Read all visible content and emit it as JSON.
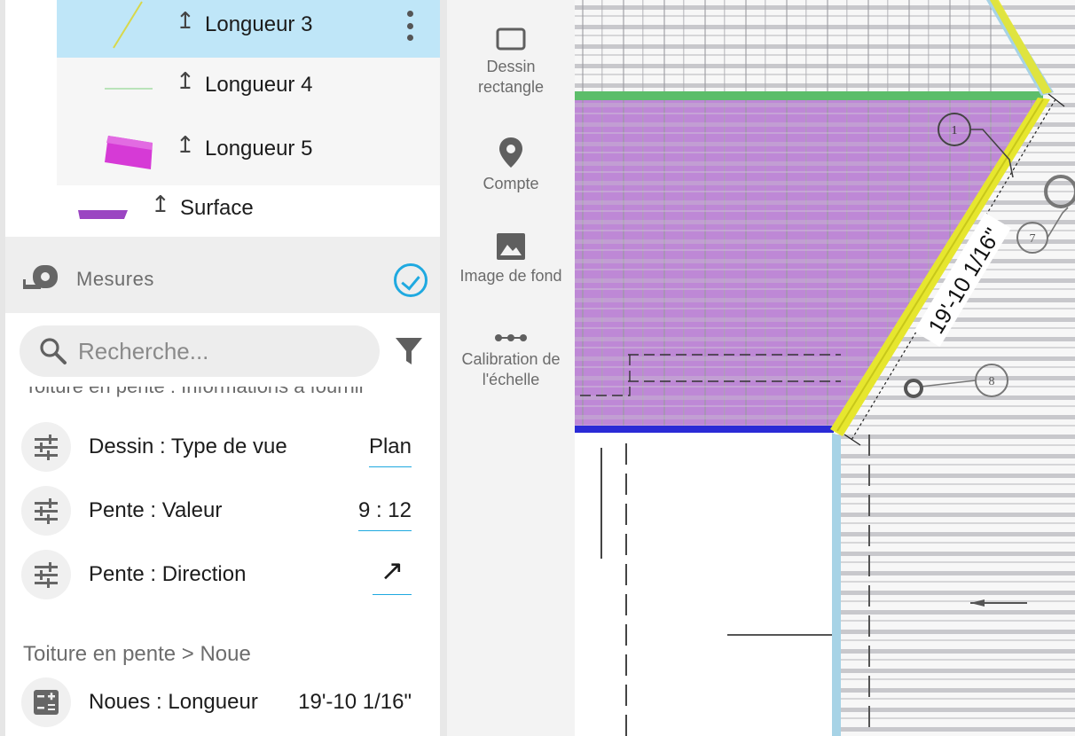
{
  "layers": [
    {
      "label": "Longueur 3",
      "pin": "↥",
      "selected": true,
      "thumb": "yellow-line"
    },
    {
      "label": "Longueur 4",
      "pin": "↥",
      "selected": false,
      "thumb": "green-line"
    },
    {
      "label": "Longueur 5",
      "pin": "↥",
      "selected": false,
      "thumb": "magenta-box"
    },
    {
      "label": "Surface",
      "pin": "↥",
      "selected": false,
      "thumb": "purple-bar"
    }
  ],
  "measures": {
    "label": "Mesures",
    "checked": true
  },
  "search": {
    "placeholder": "Recherche..."
  },
  "cut_header": "Toiture en pente : Informations à fournir",
  "properties": [
    {
      "name": "Dessin : Type de vue",
      "value": "Plan",
      "icon": "sliders-icon"
    },
    {
      "name": "Pente : Valeur",
      "value": "9 : 12",
      "icon": "sliders-icon"
    },
    {
      "name": "Pente : Direction",
      "value": "↗",
      "icon": "sliders-icon"
    }
  ],
  "section": {
    "title": "Toiture en pente > Noue"
  },
  "noue": {
    "name": "Noues : Longueur",
    "value": "19'-10 1/16\"",
    "icon": "calculator-icon"
  },
  "tools": [
    {
      "label_line1": "Dessin",
      "label_line2": "rectangle",
      "icon": "rectangle-icon"
    },
    {
      "label_line1": "Compte",
      "label_line2": "",
      "icon": "location-pin-icon"
    },
    {
      "label_line1": "Image de fond",
      "label_line2": "",
      "icon": "image-icon"
    },
    {
      "label_line1": "Calibration de",
      "label_line2": "l'échelle",
      "icon": "calibration-icon"
    }
  ],
  "canvas": {
    "dimension_label": "19'-10 1/16\"",
    "callouts": [
      "1",
      "7",
      "8"
    ],
    "colors": {
      "surface": "#b87ed3",
      "valley_line": "#e6e62e",
      "edge_green": "#5cbd6a",
      "edge_blue": "#2a2ad6",
      "edge_lightblue": "#a7d3e6",
      "selection": "#bfe6f8",
      "accent": "#1fa9e0"
    }
  }
}
